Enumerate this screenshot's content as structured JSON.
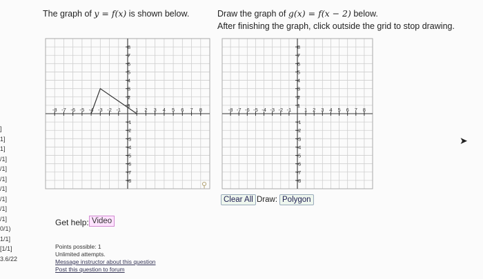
{
  "left_scores": [
    "]",
    "1]",
    "1]",
    "/1]",
    "/1]",
    "/1]",
    "/1]",
    "/1]",
    "/1]",
    "/1]",
    "0/1)",
    "1/1]",
    "[1/1]",
    "3.6/22"
  ],
  "prompt1": {
    "pre": "The graph of ",
    "math": "y = f(x)",
    "post": " is shown below."
  },
  "prompt2": {
    "pre": "Draw the graph of ",
    "math": "g(x) = f(x − 2)",
    "post": " below."
  },
  "prompt3": "After finishing the graph, click outside the grid to stop drawing.",
  "graph1": {
    "x_ticks": [
      "-8",
      "-7",
      "-6",
      "-5",
      "-4",
      "-3",
      "-2",
      "-1",
      "1",
      "2",
      "3",
      "4",
      "5",
      "6",
      "7",
      "8"
    ],
    "y_ticks_pos": [
      "8",
      "7",
      "6",
      "5",
      "4",
      "3",
      "2",
      "1"
    ],
    "y_ticks_neg": [
      "-1",
      "-2",
      "-3",
      "-4",
      "-5",
      "-6",
      "-7",
      "-8"
    ],
    "polyline": [
      [
        -4,
        0
      ],
      [
        -3,
        3
      ],
      [
        1,
        0
      ]
    ]
  },
  "graph2": {
    "x_ticks": [
      "-8",
      "-7",
      "-6",
      "-5",
      "-4",
      "-3",
      "-2",
      "-1",
      "1",
      "2",
      "3",
      "4",
      "5",
      "6",
      "7",
      "8"
    ],
    "y_ticks_pos": [
      "8",
      "7",
      "6",
      "5",
      "4",
      "3",
      "2",
      "1"
    ],
    "y_ticks_neg": [
      "-1",
      "-2",
      "-3",
      "-4",
      "-5",
      "-6",
      "-7",
      "-8"
    ]
  },
  "clear_all": "Clear All",
  "draw_label": "Draw:",
  "polygon_button": "Polygon",
  "get_help": "Get help:",
  "video_button": "Video",
  "points_possible": "Points possible: 1",
  "attempts": "Unlimited attempts.",
  "message_link": "Message instructor about this question",
  "post_link": "Post this question to forum",
  "colors": {
    "grid": "#cfcfcf",
    "axis": "#333333",
    "curve": "#333333"
  }
}
